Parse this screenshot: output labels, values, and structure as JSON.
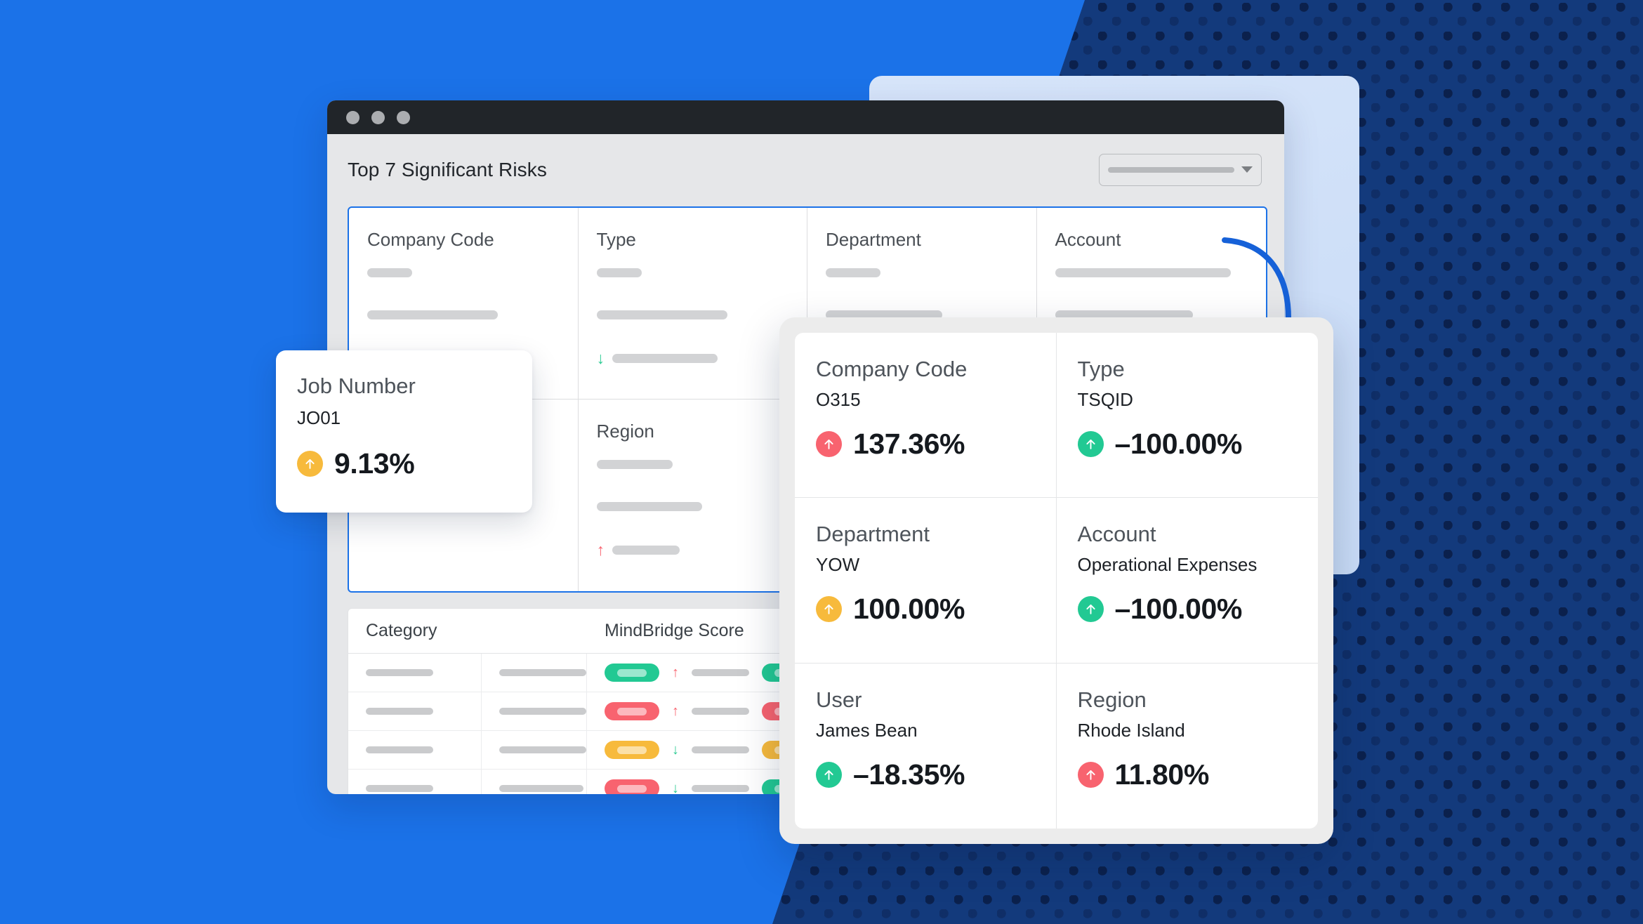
{
  "theme": {
    "brand_blue": "#1B72E8",
    "navy": "#133A7C",
    "green": "#22C993",
    "red": "#F8636F",
    "amber": "#F7BA3C",
    "back_card_blue": "#D3E3F8",
    "titlebar": "#212529"
  },
  "window": {
    "title": "Top 7 Significant Risks",
    "dots": [
      "close-dot",
      "minimize-dot",
      "maximize-dot"
    ],
    "filter_select": {
      "value": "",
      "caret": "chevron-down-icon"
    }
  },
  "kpi_grid": [
    {
      "label": "Company Code",
      "trend": "up",
      "trend_color": "#F8636F"
    },
    {
      "label": "Type",
      "trend": "down",
      "trend_color": "#2DCB93"
    },
    {
      "label": "Department",
      "trend": "",
      "trend_color": ""
    },
    {
      "label": "Account",
      "trend": "",
      "trend_color": ""
    },
    {
      "label": "User",
      "trend": "",
      "trend_color": ""
    },
    {
      "label": "Region",
      "trend": "up",
      "trend_color": "#F8636F"
    },
    {
      "label": "",
      "trend": "",
      "trend_color": ""
    },
    {
      "label": "",
      "trend": "",
      "trend_color": ""
    }
  ],
  "table": {
    "columns": [
      "Category",
      "",
      "MindBridge Score"
    ],
    "rows": [
      {
        "pill": "green",
        "arrow": "up",
        "pill2": "green"
      },
      {
        "pill": "red",
        "arrow": "up",
        "pill2": "red"
      },
      {
        "pill": "amber",
        "arrow": "down",
        "pill2": "amber"
      },
      {
        "pill": "red",
        "arrow": "down",
        "pill2": "green"
      },
      {
        "pill": "green",
        "arrow": "up",
        "pill2": "red"
      },
      {
        "pill": "green",
        "arrow": "up",
        "pill2": "red"
      },
      {
        "pill": "amber",
        "arrow": "down",
        "pill2": "green"
      }
    ]
  },
  "job_card": {
    "label": "Job Number",
    "value": "JO01",
    "percent": "9.13%",
    "indicator": "amber",
    "arrow": "up"
  },
  "detail_card": {
    "cells": [
      {
        "label": "Company Code",
        "value": "O315",
        "percent": "137.36%",
        "indicator": "red",
        "arrow": "up"
      },
      {
        "label": "Type",
        "value": "TSQID",
        "percent": "–100.00%",
        "indicator": "green",
        "arrow": "up"
      },
      {
        "label": "Department",
        "value": "YOW",
        "percent": "100.00%",
        "indicator": "amber",
        "arrow": "up"
      },
      {
        "label": "Account",
        "value": "Operational Expenses",
        "percent": "–100.00%",
        "indicator": "green",
        "arrow": "up"
      },
      {
        "label": "User",
        "value": "James Bean",
        "percent": "–18.35%",
        "indicator": "green",
        "arrow": "up"
      },
      {
        "label": "Region",
        "value": "Rhode Island",
        "percent": "11.80%",
        "indicator": "red",
        "arrow": "up"
      }
    ]
  },
  "annotation": {
    "arrow": "curved-arrow-icon",
    "color": "#1661D8"
  }
}
